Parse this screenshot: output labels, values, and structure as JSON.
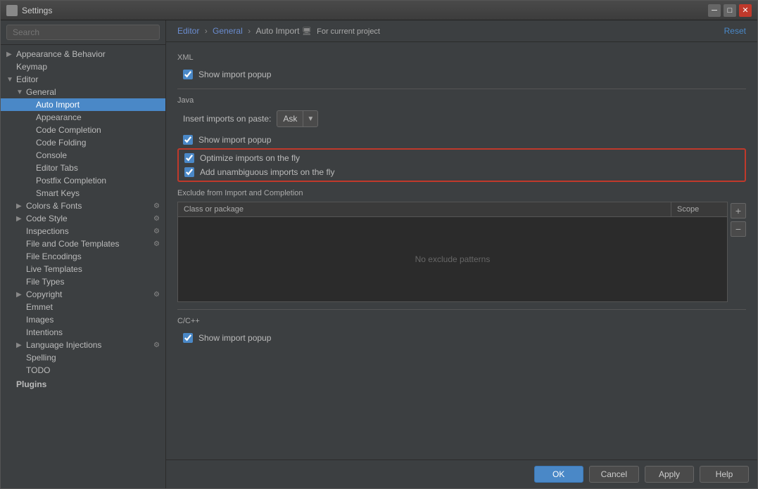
{
  "window": {
    "title": "Settings"
  },
  "breadcrumb": {
    "part1": "Editor",
    "part2": "General",
    "part3": "Auto Import",
    "for_project": "For current project"
  },
  "reset_label": "Reset",
  "sidebar": {
    "search_placeholder": "Search",
    "items": [
      {
        "id": "appearance-behavior",
        "label": "Appearance & Behavior",
        "level": 1,
        "arrow": "▶",
        "expanded": false
      },
      {
        "id": "keymap",
        "label": "Keymap",
        "level": 1,
        "arrow": "",
        "expanded": false
      },
      {
        "id": "editor",
        "label": "Editor",
        "level": 1,
        "arrow": "▼",
        "expanded": true
      },
      {
        "id": "general",
        "label": "General",
        "level": 2,
        "arrow": "▼",
        "expanded": true
      },
      {
        "id": "auto-import",
        "label": "Auto Import",
        "level": 3,
        "arrow": "",
        "selected": true
      },
      {
        "id": "appearance",
        "label": "Appearance",
        "level": 3,
        "arrow": ""
      },
      {
        "id": "code-completion",
        "label": "Code Completion",
        "level": 3,
        "arrow": ""
      },
      {
        "id": "code-folding",
        "label": "Code Folding",
        "level": 3,
        "arrow": ""
      },
      {
        "id": "console",
        "label": "Console",
        "level": 3,
        "arrow": ""
      },
      {
        "id": "editor-tabs",
        "label": "Editor Tabs",
        "level": 3,
        "arrow": ""
      },
      {
        "id": "postfix-completion",
        "label": "Postfix Completion",
        "level": 3,
        "arrow": ""
      },
      {
        "id": "smart-keys",
        "label": "Smart Keys",
        "level": 3,
        "arrow": ""
      },
      {
        "id": "colors-fonts",
        "label": "Colors & Fonts",
        "level": 2,
        "arrow": "▶",
        "hasIcon": true
      },
      {
        "id": "code-style",
        "label": "Code Style",
        "level": 2,
        "arrow": "▶",
        "hasIcon": true
      },
      {
        "id": "inspections",
        "label": "Inspections",
        "level": 2,
        "arrow": "",
        "hasIcon": true
      },
      {
        "id": "file-code-templates",
        "label": "File and Code Templates",
        "level": 2,
        "arrow": "",
        "hasIcon": true
      },
      {
        "id": "file-encodings",
        "label": "File Encodings",
        "level": 2,
        "arrow": ""
      },
      {
        "id": "live-templates",
        "label": "Live Templates",
        "level": 2,
        "arrow": ""
      },
      {
        "id": "file-types",
        "label": "File Types",
        "level": 2,
        "arrow": ""
      },
      {
        "id": "copyright",
        "label": "Copyright",
        "level": 2,
        "arrow": "▶",
        "hasIcon": true
      },
      {
        "id": "emmet",
        "label": "Emmet",
        "level": 2,
        "arrow": ""
      },
      {
        "id": "images",
        "label": "Images",
        "level": 2,
        "arrow": ""
      },
      {
        "id": "intentions",
        "label": "Intentions",
        "level": 2,
        "arrow": ""
      },
      {
        "id": "language-injections",
        "label": "Language Injections",
        "level": 2,
        "arrow": "▶",
        "hasIcon": true
      },
      {
        "id": "spelling",
        "label": "Spelling",
        "level": 2,
        "arrow": ""
      },
      {
        "id": "todo",
        "label": "TODO",
        "level": 2,
        "arrow": ""
      },
      {
        "id": "plugins",
        "label": "Plugins",
        "level": 1,
        "arrow": "",
        "bold": true
      }
    ]
  },
  "content": {
    "xml_section": "XML",
    "xml_show_import_popup": "Show import popup",
    "xml_show_import_checked": true,
    "java_section": "Java",
    "insert_imports_label": "Insert imports on paste:",
    "insert_imports_value": "Ask",
    "java_show_import_popup": "Show import popup",
    "java_show_import_checked": true,
    "optimize_imports": "Optimize imports on the fly",
    "optimize_imports_checked": true,
    "add_unambiguous": "Add unambiguous imports on the fly",
    "add_unambiguous_checked": true,
    "exclude_label": "Exclude from Import and Completion",
    "col_class_package": "Class or package",
    "col_scope": "Scope",
    "no_patterns": "No exclude patterns",
    "cpp_section": "C/C++",
    "cpp_show_import_popup": "Show import popup",
    "cpp_show_import_checked": true
  },
  "buttons": {
    "ok": "OK",
    "cancel": "Cancel",
    "apply": "Apply",
    "help": "Help"
  }
}
